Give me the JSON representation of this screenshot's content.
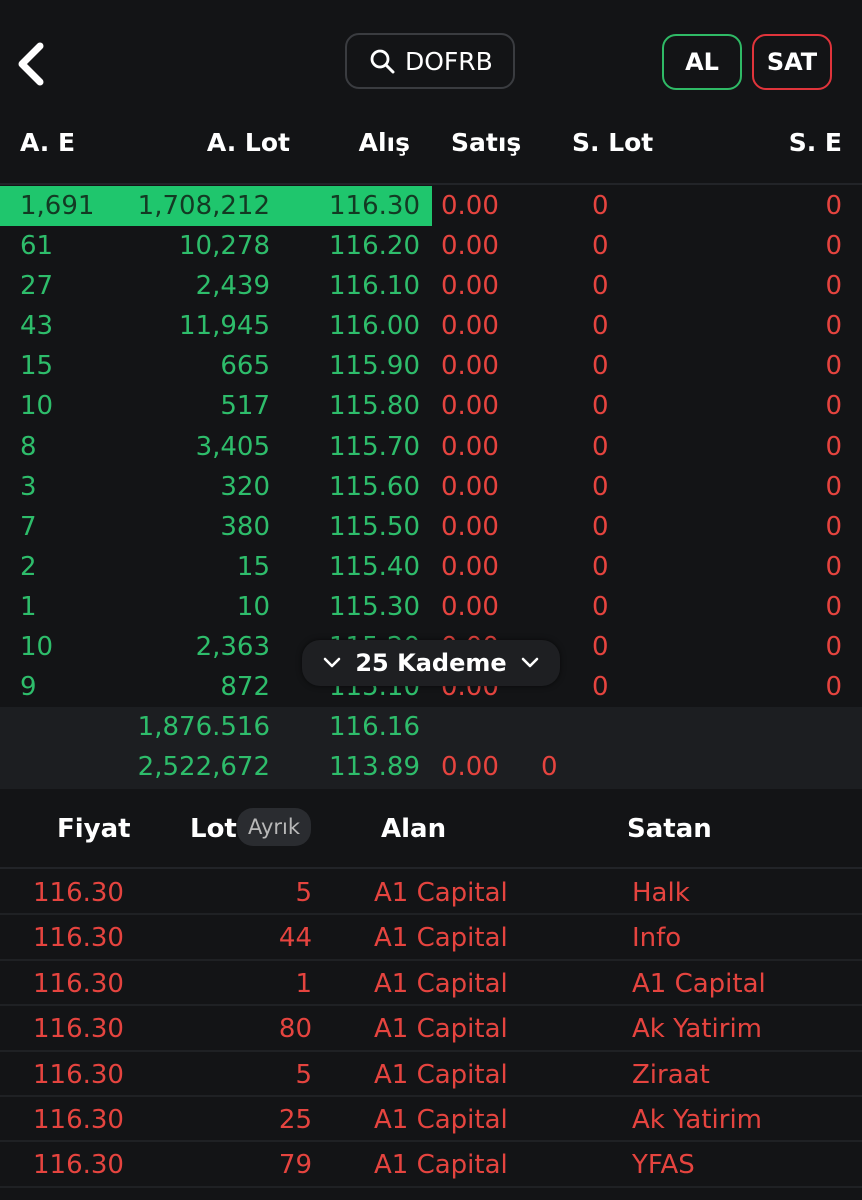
{
  "header": {
    "symbol": "DOFRB",
    "buy_label": "AL",
    "sell_label": "SAT",
    "colors": {
      "buy": "#2fba66",
      "sell": "#e0343b"
    }
  },
  "columns": {
    "ae": "A. E",
    "alot": "A. Lot",
    "alis": "Alış",
    "satis": "Satış",
    "slot": "S. Lot",
    "se": "S. E"
  },
  "depth_rows": [
    {
      "ae": "1,691",
      "alot": "1,708,212",
      "alis": "116.30",
      "satis": "0.00",
      "slot": "0",
      "se": "0"
    },
    {
      "ae": "61",
      "alot": "10,278",
      "alis": "116.20",
      "satis": "0.00",
      "slot": "0",
      "se": "0"
    },
    {
      "ae": "27",
      "alot": "2,439",
      "alis": "116.10",
      "satis": "0.00",
      "slot": "0",
      "se": "0"
    },
    {
      "ae": "43",
      "alot": "11,945",
      "alis": "116.00",
      "satis": "0.00",
      "slot": "0",
      "se": "0"
    },
    {
      "ae": "15",
      "alot": "665",
      "alis": "115.90",
      "satis": "0.00",
      "slot": "0",
      "se": "0"
    },
    {
      "ae": "10",
      "alot": "517",
      "alis": "115.80",
      "satis": "0.00",
      "slot": "0",
      "se": "0"
    },
    {
      "ae": "8",
      "alot": "3,405",
      "alis": "115.70",
      "satis": "0.00",
      "slot": "0",
      "se": "0"
    },
    {
      "ae": "3",
      "alot": "320",
      "alis": "115.60",
      "satis": "0.00",
      "slot": "0",
      "se": "0"
    },
    {
      "ae": "7",
      "alot": "380",
      "alis": "115.50",
      "satis": "0.00",
      "slot": "0",
      "se": "0"
    },
    {
      "ae": "2",
      "alot": "15",
      "alis": "115.40",
      "satis": "0.00",
      "slot": "0",
      "se": "0"
    },
    {
      "ae": "1",
      "alot": "10",
      "alis": "115.30",
      "satis": "0.00",
      "slot": "0",
      "se": "0"
    },
    {
      "ae": "10",
      "alot": "2,363",
      "alis": "115.20",
      "satis": "0.00",
      "slot": "0",
      "se": "0"
    },
    {
      "ae": "9",
      "alot": "872",
      "alis": "115.10",
      "satis": "0.00",
      "slot": "0",
      "se": "0"
    }
  ],
  "totals": {
    "row1": {
      "lot": "1,876.516",
      "price": "116.16"
    },
    "row2": {
      "lot": "2,522,672",
      "price": "113.89",
      "satis": "0.00",
      "slot": "0"
    }
  },
  "kademe_label": "25 Kademe",
  "trades_header": {
    "fiyat": "Fiyat",
    "lot": "Lot",
    "lot_mode": "Ayrık",
    "alan": "Alan",
    "satan": "Satan"
  },
  "trades": [
    {
      "fiyat": "116.30",
      "lot": "5",
      "alan": "A1 Capital",
      "satan": "Halk"
    },
    {
      "fiyat": "116.30",
      "lot": "44",
      "alan": "A1 Capital",
      "satan": "Info"
    },
    {
      "fiyat": "116.30",
      "lot": "1",
      "alan": "A1 Capital",
      "satan": "A1 Capital"
    },
    {
      "fiyat": "116.30",
      "lot": "80",
      "alan": "A1 Capital",
      "satan": "Ak Yatirim"
    },
    {
      "fiyat": "116.30",
      "lot": "5",
      "alan": "A1 Capital",
      "satan": "Ziraat"
    },
    {
      "fiyat": "116.30",
      "lot": "25",
      "alan": "A1 Capital",
      "satan": "Ak Yatirim"
    },
    {
      "fiyat": "116.30",
      "lot": "79",
      "alan": "A1 Capital",
      "satan": "YFAS"
    }
  ],
  "icons": [
    "back-chevron-icon",
    "search-icon",
    "chevron-down-icon"
  ]
}
